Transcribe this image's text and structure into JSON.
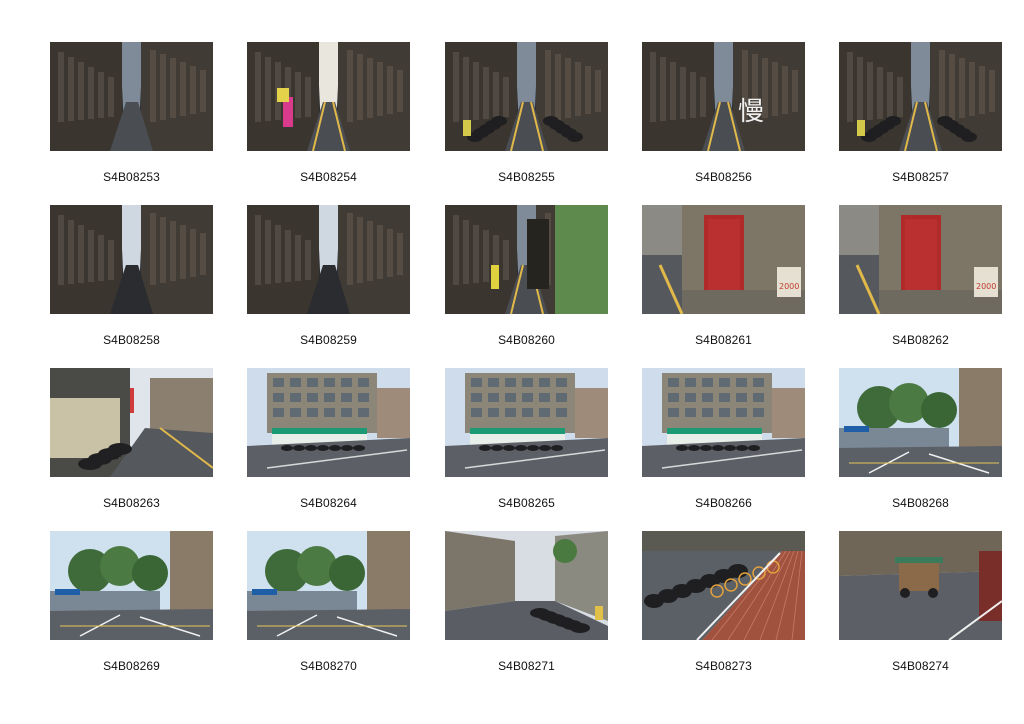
{
  "contact_sheet": {
    "rows": [
      [
        "S4B08253",
        "S4B08254",
        "S4B08255",
        "S4B08256",
        "S4B08257"
      ],
      [
        "S4B08258",
        "S4B08259",
        "S4B08260",
        "S4B08261",
        "S4B08262"
      ],
      [
        "S4B08263",
        "S4B08264",
        "S4B08265",
        "S4B08266",
        "S4B08268"
      ],
      [
        "S4B08269",
        "S4B08270",
        "S4B08271",
        "S4B08273",
        "S4B08274"
      ]
    ],
    "thumb_styles": [
      "alley-dark",
      "alley-lit",
      "alley-scooters",
      "alley-road-marking",
      "alley-scooters",
      "alley-sky",
      "alley-sky",
      "alley-green-wall",
      "red-door",
      "red-door",
      "storefront",
      "corner-shop",
      "corner-shop",
      "corner-shop",
      "street-trees",
      "street-trees",
      "street-trees",
      "street-scooters",
      "bike-rack",
      "street-cart"
    ],
    "road_marking_text": "慢",
    "sign_text": "2000"
  }
}
